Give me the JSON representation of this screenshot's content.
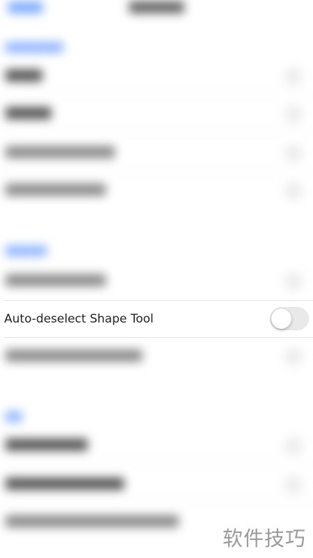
{
  "settings": {
    "toggle_row": {
      "label": "Auto-deselect Shape Tool",
      "enabled": false
    }
  },
  "watermark": {
    "text": "软件技巧"
  },
  "colors": {
    "toggle_track": "#e9e9ea",
    "toggle_knob": "#ffffff",
    "label_text": "#222222"
  }
}
